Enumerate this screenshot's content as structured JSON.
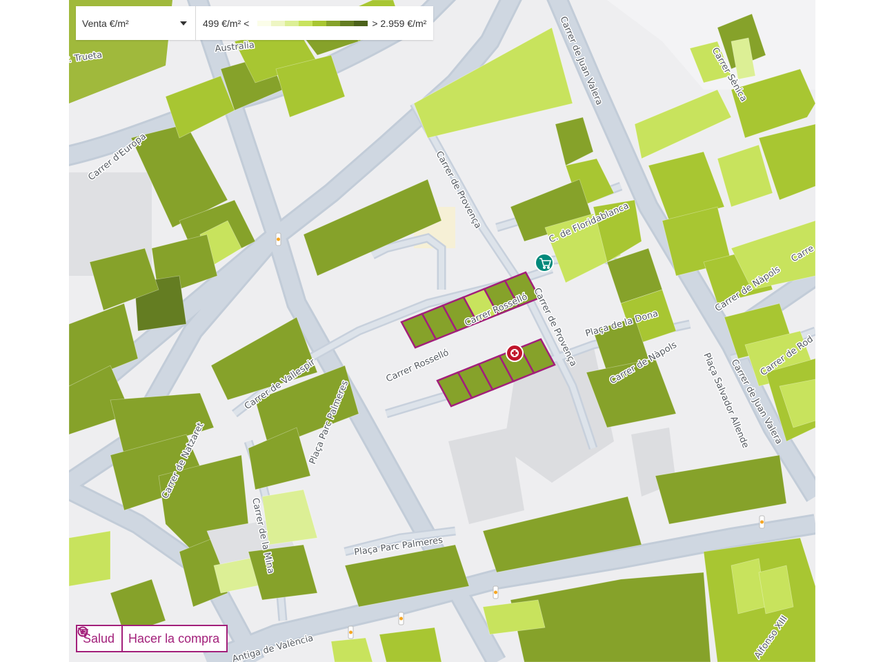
{
  "filter": {
    "selected_label": "Venta €/m²",
    "icon": "chevron-down-icon"
  },
  "legend": {
    "min_label": "499 €/m² <",
    "max_label": "> 2.959 €/m²",
    "colors": [
      "#fbfde9",
      "#eef6c3",
      "#dcef95",
      "#c8e35d",
      "#a8c632",
      "#86a22a",
      "#647d22",
      "#4c621b"
    ]
  },
  "streets": [
    {
      "name": "Dr. Trueta"
    },
    {
      "name": "Australia"
    },
    {
      "name": "Carrer d'Europa"
    },
    {
      "name": "Carrer de Provença"
    },
    {
      "name": "Carrer de Juan Valera"
    },
    {
      "name": "Carrer Sènica"
    },
    {
      "name": "C. de Floridablanca"
    },
    {
      "name": "Carrer Rosselló"
    },
    {
      "name": "Carrer Rosselló"
    },
    {
      "name": "Carrer de Provença"
    },
    {
      "name": "Plaça de la Dona"
    },
    {
      "name": "Carrer de Nàpols"
    },
    {
      "name": "Carrer de Nàpols"
    },
    {
      "name": "Carrer de Vallespir"
    },
    {
      "name": "Plaça Parc Palmeres"
    },
    {
      "name": "Carrer de Natzaret"
    },
    {
      "name": "Plaça Salvador Allende"
    },
    {
      "name": "Carrer de Juan Valera"
    },
    {
      "name": "Carrer de Rod"
    },
    {
      "name": "Carrer de la Mina"
    },
    {
      "name": "Plaça Parc Palmeres"
    },
    {
      "name": "Antiga de València"
    },
    {
      "name": "Alfonso XIII"
    },
    {
      "name": "Carre"
    }
  ],
  "pois": [
    {
      "type": "supermarket",
      "icon": "shopping-cart-icon",
      "color": "#00897b"
    },
    {
      "type": "health",
      "icon": "health-cross-icon",
      "color": "#c0142b"
    }
  ],
  "selection_color": "#a21f7a",
  "buttons": {
    "health": {
      "label": "Salud",
      "icon": "plus-circle-icon"
    },
    "shopping": {
      "label": "Hacer la compra",
      "icon": "shopping-cart-icon"
    }
  }
}
